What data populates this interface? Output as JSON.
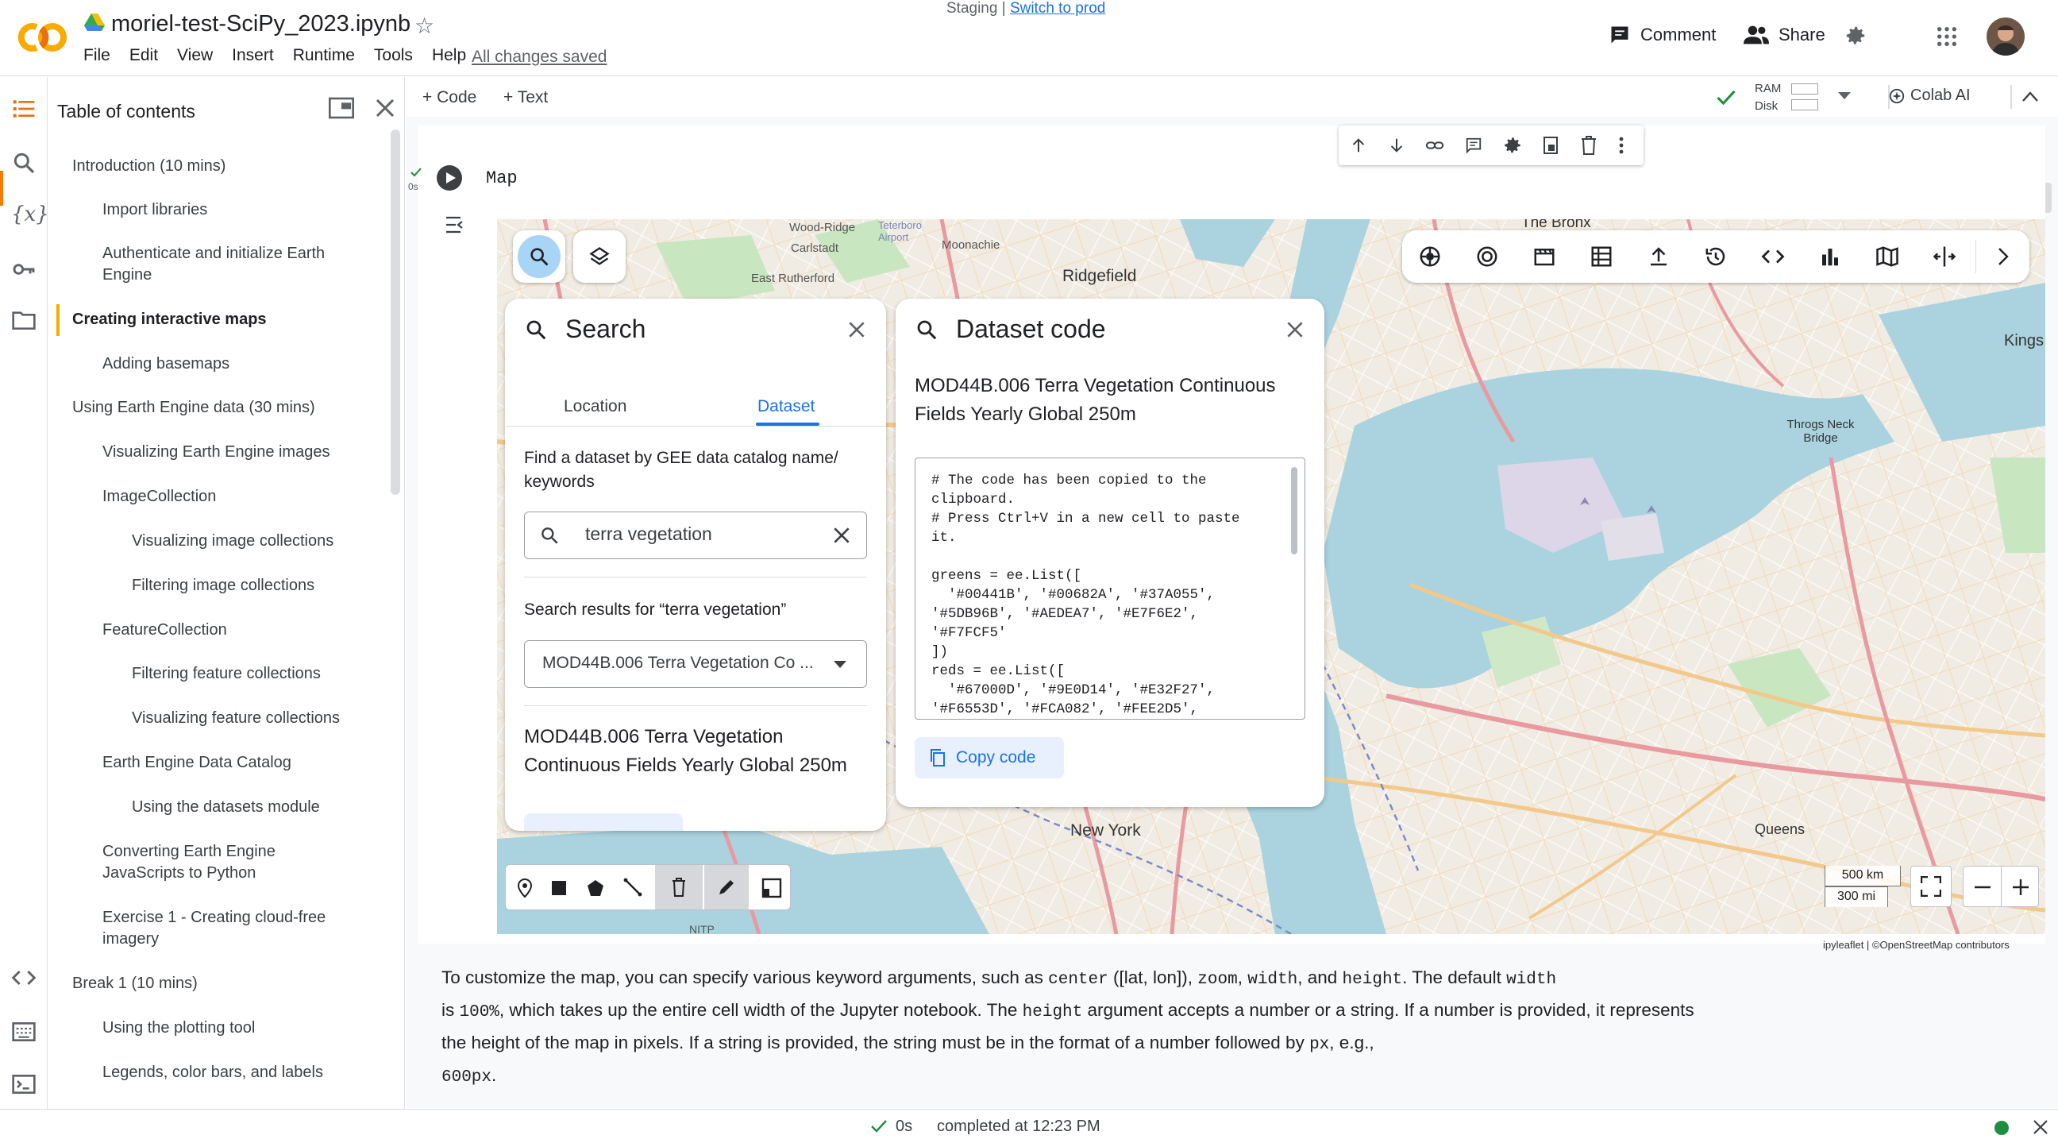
{
  "app": {
    "notebook_title": "moriel-test-SciPy_2023.ipynb",
    "menus": [
      "File",
      "Edit",
      "View",
      "Insert",
      "Runtime",
      "Tools",
      "Help"
    ],
    "saved_status": "All changes saved",
    "env_label": "Staging | ",
    "env_link": "Switch to prod",
    "comment_label": "Comment",
    "share_label": "Share",
    "add_code": "+ Code",
    "add_text": "+ Text",
    "ram_label": "RAM",
    "disk_label": "Disk",
    "colab_ai": "Colab AI"
  },
  "toc": {
    "title": "Table of contents",
    "items": [
      {
        "label": "Introduction (10 mins)",
        "level": 0
      },
      {
        "label": "Import libraries",
        "level": 1
      },
      {
        "label": "Authenticate and initialize Earth Engine",
        "level": 1
      },
      {
        "label": "Creating interactive maps",
        "level": 0,
        "active": true
      },
      {
        "label": "Adding basemaps",
        "level": 1
      },
      {
        "label": "Using Earth Engine data (30 mins)",
        "level": 0
      },
      {
        "label": "Visualizing Earth Engine images",
        "level": 1
      },
      {
        "label": "ImageCollection",
        "level": 1
      },
      {
        "label": "Visualizing image collections",
        "level": 2
      },
      {
        "label": "Filtering image collections",
        "level": 2
      },
      {
        "label": "FeatureCollection",
        "level": 1
      },
      {
        "label": "Filtering feature collections",
        "level": 2
      },
      {
        "label": "Visualizing feature collections",
        "level": 2
      },
      {
        "label": "Earth Engine Data Catalog",
        "level": 1
      },
      {
        "label": "Using the datasets module",
        "level": 2
      },
      {
        "label": "Converting Earth Engine JavaScripts to Python",
        "level": 1
      },
      {
        "label": "Exercise 1 - Creating cloud-free imagery",
        "level": 1
      },
      {
        "label": "Break 1 (10 mins)",
        "level": 0
      },
      {
        "label": "Using the plotting tool",
        "level": 1
      },
      {
        "label": "Legends, color bars, and labels",
        "level": 1
      }
    ]
  },
  "cell": {
    "exec_time": "0s",
    "title": "Map"
  },
  "search_panel": {
    "title": "Search",
    "tab_location": "Location",
    "tab_dataset": "Dataset",
    "prompt": "Find a dataset by GEE data catalog name/ keywords",
    "input_value": "terra vegetation",
    "results_label": "Search results for “terra vegetation”",
    "selected_result": "MOD44B.006 Terra Vegetation Co ...",
    "result_title": "MOD44B.006 Terra Vegetation Continuous Fields Yearly Global 250m"
  },
  "code_panel": {
    "title": "Dataset code",
    "dataset_title": "MOD44B.006 Terra Vegetation Continuous Fields Yearly Global 250m",
    "code_lines": [
      "# The code has been copied to the",
      "clipboard.",
      "# Press Ctrl+V in a new cell to paste",
      "it.",
      "",
      "greens = ee.List([",
      "  '#00441B', '#00682A', '#37A055',",
      "'#5DB96B', '#AEDEA7', '#E7F6E2',",
      "'#F7FCF5'",
      "])",
      "reds = ee.List([",
      "  '#67000D', '#9E0D14', '#E32F27',",
      "'#F6553D', '#FCA082', '#FEE2D5',"
    ],
    "copy_label": "Copy code"
  },
  "map": {
    "labels": [
      {
        "text": "Wood-Ridge"
      },
      {
        "text": "Teterboro Airport"
      },
      {
        "text": "Carlstadt"
      },
      {
        "text": "Moonachie"
      },
      {
        "text": "East Rutherford"
      },
      {
        "text": "Ridgefield"
      },
      {
        "text": "The Bronx"
      },
      {
        "text": "Kings"
      },
      {
        "text": "Throgs Neck Bridge"
      },
      {
        "text": "New York"
      },
      {
        "text": "Queens"
      },
      {
        "text": "NITP"
      }
    ],
    "scale_km": "500 km",
    "scale_mi": "300 mi",
    "attribution": "ipyleaflet | ©OpenStreetMap contributors"
  },
  "description": {
    "p1": "To customize the map, you can specify various keyword arguments, such as ",
    "c_center": "center",
    "p2": " ([lat, lon]), ",
    "c_zoom": "zoom",
    "p3": ", ",
    "c_width": "width",
    "p4": ", and ",
    "c_height": "height",
    "p5": ". The default ",
    "c_width2": "width",
    "p6": "is ",
    "c_100": "100%",
    "p7": ", which takes up the entire cell width of the Jupyter notebook. The ",
    "c_height2": "height",
    "p8": " argument accepts a number or a string. If a number is provided, it represents the height of the map in pixels. If a string is provided, the string must be in the format of a number followed by ",
    "c_px": "px",
    "p9": ", e.g.,",
    "c_600": "600px",
    "p10": "."
  },
  "status": {
    "time": "0s",
    "completed": "completed at 12:23 PM"
  },
  "colors": {
    "accent": "#1a73e8",
    "water": "#aad3df",
    "land": "#f0ece3",
    "road": "#e89aa0",
    "major_road": "#f3c98b",
    "ok_green": "#1e8e3e"
  }
}
